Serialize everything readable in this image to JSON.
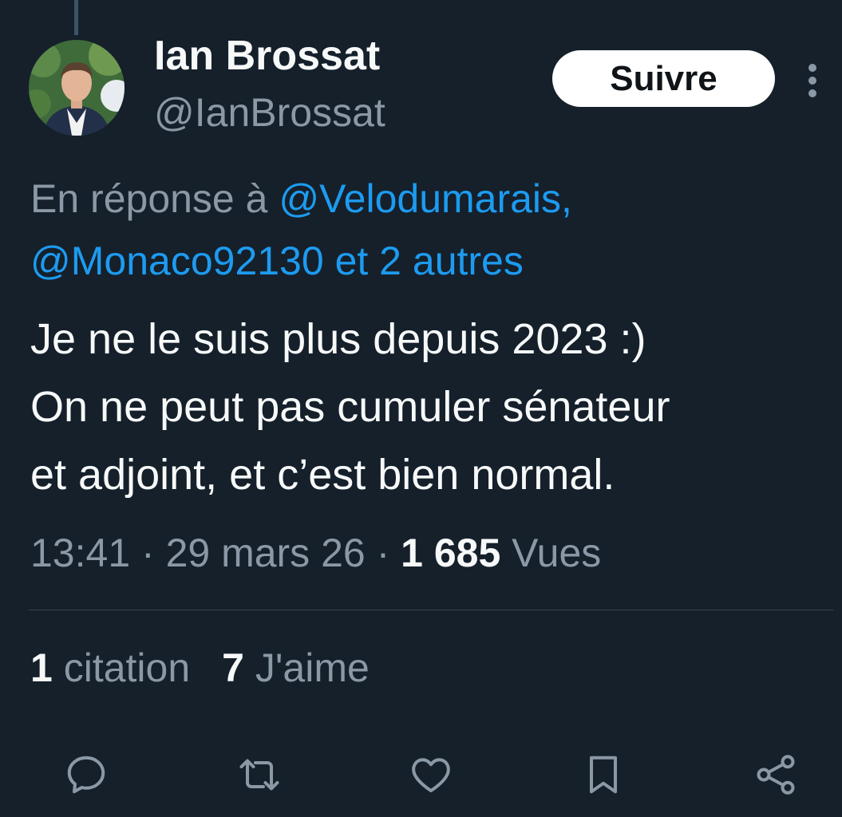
{
  "author": {
    "display_name": "Ian Brossat",
    "handle": "@IanBrossat"
  },
  "header": {
    "follow_label": "Suivre",
    "more_icon": "more-vertical-icon"
  },
  "reply": {
    "prefix": "En réponse à ",
    "mention_1": "@Velodumarais,",
    "mention_2": "@Monaco92130",
    "others": "et 2 autres"
  },
  "tweet": {
    "lines": [
      "Je ne le suis plus depuis 2023 :)",
      "On ne peut pas cumuler sénateur",
      "et adjoint, et c’est bien normal."
    ]
  },
  "meta": {
    "time": "13:41",
    "separator": " · ",
    "date": "29 mars 26",
    "views_count": "1 685",
    "views_label": "Vues"
  },
  "stats": {
    "quotes_count": "1",
    "quotes_label": "citation",
    "likes_count": "7",
    "likes_label": "J'aime"
  },
  "actions": {
    "icons": [
      "reply-icon",
      "retweet-icon",
      "like-icon",
      "bookmark-icon",
      "share-icon"
    ]
  },
  "colors": {
    "background": "#15202b",
    "text_primary": "#f7f9f9",
    "text_secondary": "#8b98a5",
    "accent_blue": "#1d9bf0",
    "divider": "#38444d"
  }
}
